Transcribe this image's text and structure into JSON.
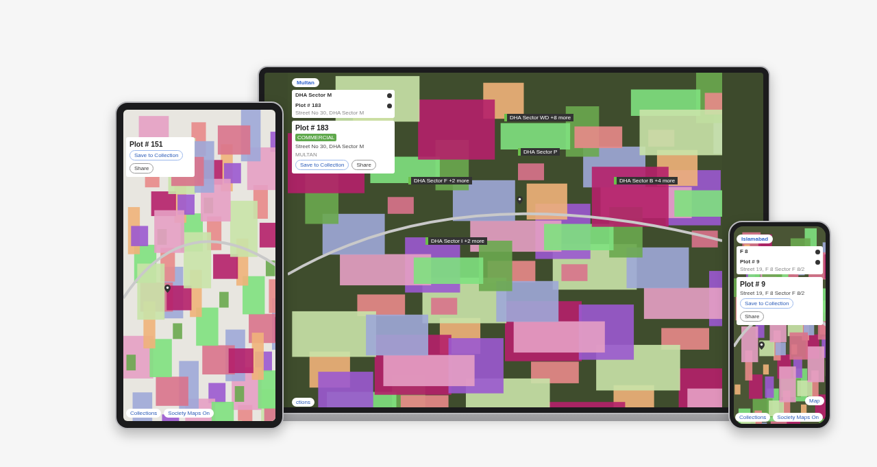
{
  "laptop": {
    "city": "Multan",
    "search_results": [
      {
        "title": "DHA Sector M"
      },
      {
        "title": "Plot # 183",
        "subtitle": "Street No 30, DHA Sector M"
      }
    ],
    "plot": {
      "title": "Plot # 183",
      "tag": "COMMERCIAL",
      "address": "Street No 30, DHA Sector M",
      "city": "MULTAN",
      "buttons": [
        "Save to Collection",
        "Share"
      ]
    },
    "map_labels": [
      "DHA Sector WD +8 more",
      "DHA Sector P",
      "DHA Sector F +2 more",
      "DHA Sector B +4 more",
      "DHA Sector I +2 more"
    ],
    "bottom_button": "ctions"
  },
  "tablet": {
    "plot": {
      "title": "Plot # 151",
      "buttons": [
        "Save to Collection",
        "Share"
      ]
    },
    "bottom_buttons": [
      "Collections",
      "Society Maps On"
    ]
  },
  "phone": {
    "city": "Islamabad",
    "search_results": [
      {
        "title": "F 8"
      },
      {
        "title": "Plot # 9",
        "subtitle": "Street 19, F 8 Sector F 8/2"
      }
    ],
    "plot": {
      "title": "Plot # 9",
      "address": "Street 19, F 8 Sector F 8/2",
      "buttons": [
        "Save to Collection",
        "Share"
      ]
    },
    "map_button": "Map",
    "bottom_buttons": [
      "Collections",
      "Society Maps On"
    ]
  }
}
